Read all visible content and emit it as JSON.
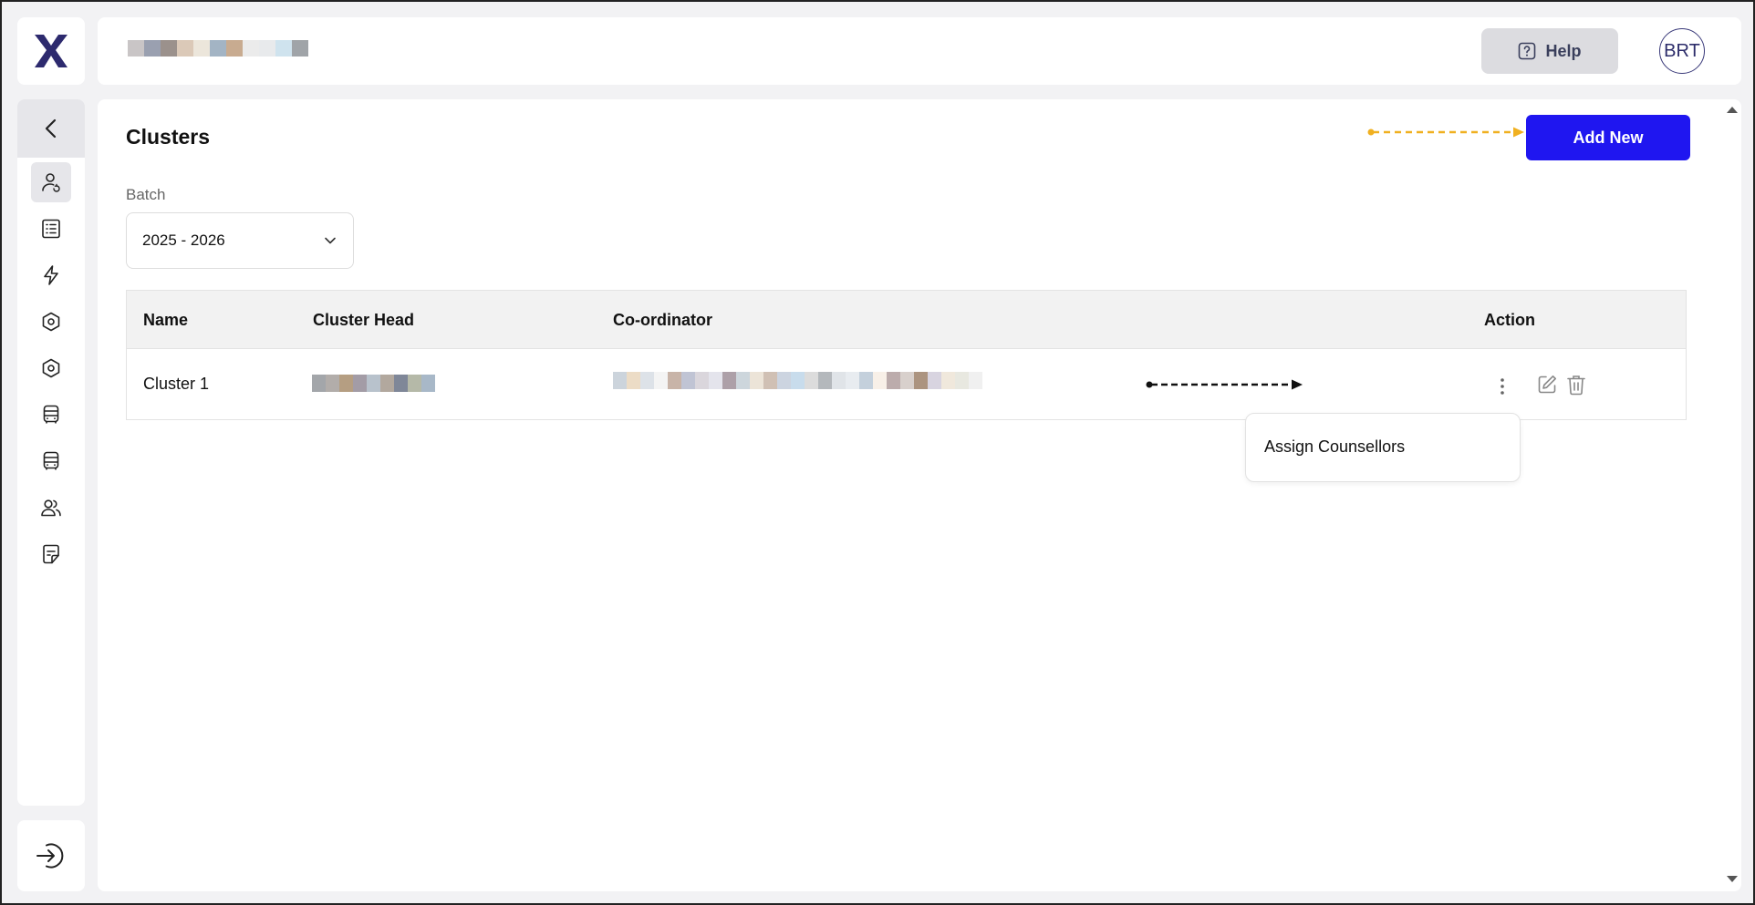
{
  "header": {
    "help_label": "Help",
    "avatar_initials": "BRT"
  },
  "sidebar": {
    "items": [
      {
        "icon": "user-refresh-icon",
        "active": true
      },
      {
        "icon": "list-doc-icon"
      },
      {
        "icon": "lightning-icon"
      },
      {
        "icon": "settings-hex-icon"
      },
      {
        "icon": "settings-hex-icon-2"
      },
      {
        "icon": "bus-icon"
      },
      {
        "icon": "bus-icon-2"
      },
      {
        "icon": "users-icon"
      },
      {
        "icon": "notes-icon"
      }
    ]
  },
  "page": {
    "title": "Clusters",
    "add_button": "Add New",
    "batch_label": "Batch",
    "batch_value": "2025 - 2026"
  },
  "table": {
    "headers": {
      "name": "Name",
      "cluster_head": "Cluster Head",
      "coordinator": "Co-ordinator",
      "action": "Action"
    },
    "rows": [
      {
        "name": "Cluster 1"
      }
    ]
  },
  "menu": {
    "assign_counsellors": "Assign Counsellors"
  },
  "colors": {
    "primary": "#1f16f0",
    "logo": "#2d2a6e",
    "hint_arrow_yellow": "#f0b020"
  }
}
